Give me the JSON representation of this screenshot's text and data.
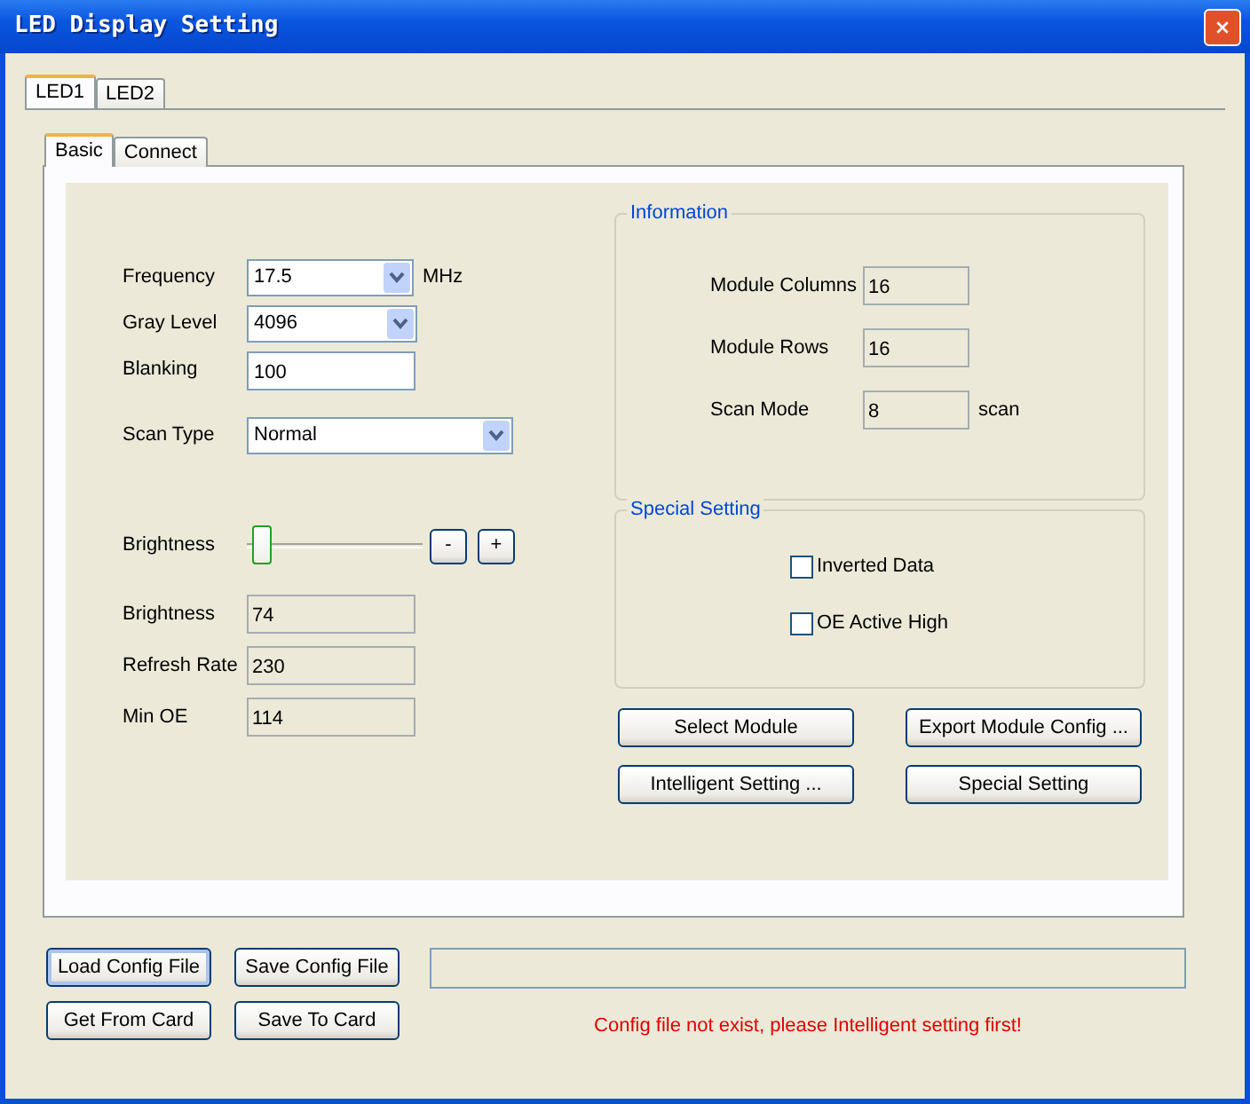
{
  "window": {
    "title": "LED Display Setting"
  },
  "tabs": [
    {
      "label": "LED1",
      "selected": true
    },
    {
      "label": "LED2",
      "selected": false
    }
  ],
  "subtabs": [
    {
      "label": "Basic",
      "selected": true
    },
    {
      "label": "Connect",
      "selected": false
    }
  ],
  "basic_fields": [
    {
      "kind": "dropdown",
      "label": "Frequency",
      "value": "17.5",
      "unit": "MHz"
    },
    {
      "kind": "dropdown",
      "label": "Gray Level",
      "value": "4096"
    },
    {
      "kind": "text",
      "label": "Blanking",
      "value": "100"
    }
  ],
  "scan_type": {
    "label": "Scan Type",
    "value": "Normal"
  },
  "brightness_slider": {
    "label": "Brightness",
    "level": 0.03,
    "buttons": [
      "-",
      "+"
    ]
  },
  "readouts": [
    {
      "label": "Brightness",
      "value": "74"
    },
    {
      "label": "Refresh Rate",
      "value": "230"
    },
    {
      "label": "Min OE",
      "value": "114"
    }
  ],
  "information": {
    "title": "Information",
    "rows": [
      {
        "label": "Module Columns",
        "value": "16"
      },
      {
        "label": "Module Rows",
        "value": "16"
      },
      {
        "label": "Scan Mode",
        "value": "8",
        "unit": "scan"
      }
    ]
  },
  "special_setting": {
    "title": "Special Setting",
    "options": [
      {
        "label": "Inverted Data",
        "checked": false
      },
      {
        "label": "OE Active High",
        "checked": false
      }
    ]
  },
  "module_buttons": [
    "Select Module",
    "Export Module Config ...",
    "Intelligent Setting ...",
    "Special Setting"
  ],
  "file_buttons": [
    {
      "label": "Load Config File",
      "focused": true
    },
    {
      "label": "Save Config File",
      "focused": false
    },
    {
      "label": "Get From Card",
      "focused": false
    },
    {
      "label": "Save To Card",
      "focused": false
    }
  ],
  "message": "Config file not exist, please Intelligent setting first!"
}
